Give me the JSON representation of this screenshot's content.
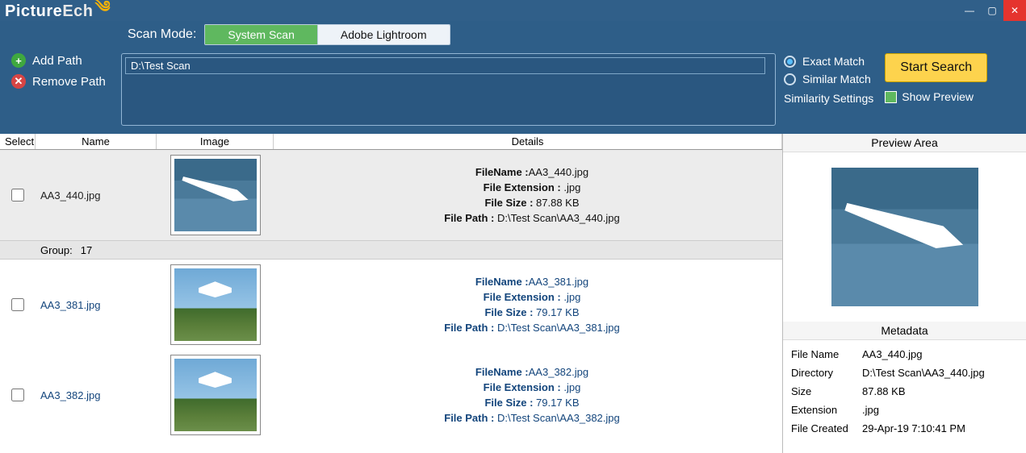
{
  "app": {
    "name": "PictureEcho"
  },
  "header": {
    "scan_mode_label": "Scan Mode:",
    "tabs": {
      "system": "System Scan",
      "lightroom": "Adobe Lightroom"
    },
    "add_path": "Add Path",
    "remove_path": "Remove Path",
    "path_value": "D:\\Test Scan",
    "match": {
      "exact": "Exact Match",
      "similar": "Similar Match",
      "settings": "Similarity Settings"
    },
    "start_search": "Start Search",
    "show_preview": "Show Preview"
  },
  "columns": {
    "select": "Select",
    "name": "Name",
    "image": "Image",
    "details": "Details"
  },
  "labels": {
    "filename": "FileName :",
    "ext": "File Extension :",
    "size": "File Size :",
    "path": "File Path  :",
    "group": "Group:"
  },
  "group_number": "17",
  "rows": [
    {
      "name": "AA3_440.jpg",
      "filename": "AA3_440.jpg",
      "ext": ".jpg",
      "size": "87.88 KB",
      "path": "D:\\Test Scan\\AA3_440.jpg",
      "kind": "sky1",
      "selected": true
    },
    {
      "name": "AA3_381.jpg",
      "filename": "AA3_381.jpg",
      "ext": ".jpg",
      "size": "79.17 KB",
      "path": "D:\\Test Scan\\AA3_381.jpg",
      "kind": "sky2",
      "selected": false
    },
    {
      "name": "AA3_382.jpg",
      "filename": "AA3_382.jpg",
      "ext": ".jpg",
      "size": "79.17 KB",
      "path": "D:\\Test Scan\\AA3_382.jpg",
      "kind": "sky2",
      "selected": false
    }
  ],
  "preview": {
    "title": "Preview Area"
  },
  "metadata": {
    "title": "Metadata",
    "keys": {
      "filename": "File Name",
      "directory": "Directory",
      "size": "Size",
      "ext": "Extension",
      "created": "File Created"
    },
    "values": {
      "filename": "AA3_440.jpg",
      "directory": "D:\\Test Scan\\AA3_440.jpg",
      "size": "87.88 KB",
      "ext": ".jpg",
      "created": "29-Apr-19 7:10:41 PM"
    }
  }
}
